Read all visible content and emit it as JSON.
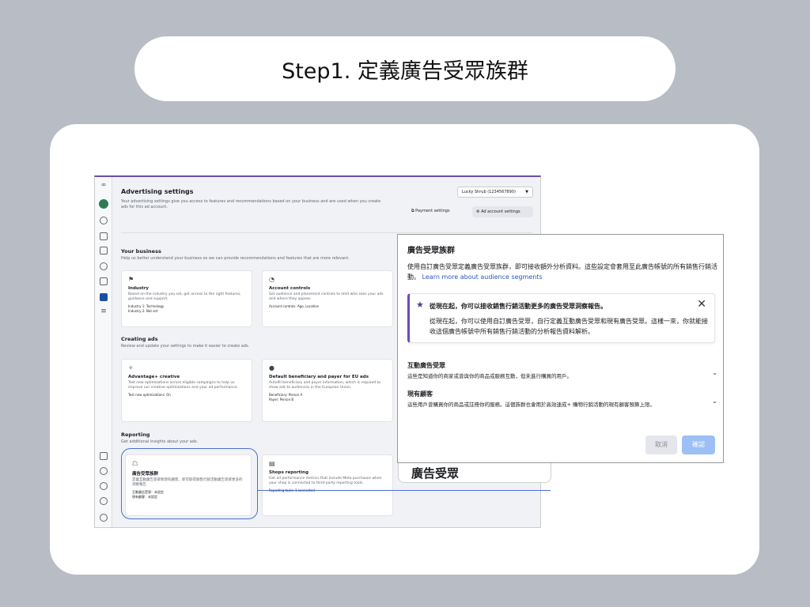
{
  "slide": {
    "heading": "Step1. 定義廣告受眾族群"
  },
  "screenshot": {
    "header": {
      "title": "Advertising settings",
      "description": "Your advertising settings give you access to features and recommendations based on your business and are used when you create ads for this ad account.",
      "account_select": "Lucky Shrub (1234567890)",
      "payment_settings": "Payment settings",
      "ad_account_settings": "Ad account settings"
    },
    "sections": {
      "business": {
        "title": "Your business",
        "desc": "Help us better understand your business so we can provide recommendations and features that are more relevant.",
        "industry": {
          "title": "Industry",
          "desc": "Based on the industry you set, get access to the right features, guidance and support.",
          "meta1": "Industry 1: Technology",
          "meta2": "Industry 2: Not set"
        },
        "account_controls": {
          "title": "Account controls",
          "desc": "Set audience and placement controls to limit who sees your ads and where they appear.",
          "meta1": "Account controls: Age, Location"
        }
      },
      "creating": {
        "title": "Creating ads",
        "desc": "Review and update your settings to make it easier to create ads.",
        "advantage": {
          "title": "Advantage+ creative",
          "desc": "Test new optimizations across eligible campaigns to help us improve our creative optimizations and your ad performance.",
          "meta1": "Test new optimizations: On"
        },
        "beneficiary": {
          "title": "Default beneficiary and payer for EU ads",
          "desc": "Autofill beneficiary and payer information, which is required to show ads to audiences in the European Union.",
          "meta1": "Beneficiary: Person A",
          "meta2": "Payer: Person B"
        }
      },
      "reporting": {
        "title": "Reporting",
        "desc": "Get additional insights about your ads.",
        "audience": {
          "title": "廣告受眾族群",
          "desc": "定義互動廣告受眾和現有顧客，即可取得銷售行銷活動廣告受眾更多的洞察報告",
          "meta1": "互動廣告受眾：未設定",
          "meta2": "現有顧客：未設定"
        },
        "shops": {
          "title": "Shops reporting",
          "desc": "Get ad performance metrics that include Meta purchases when your shop is connected to third-party reporting tools.",
          "meta1": "Reporting tools: 1 connected"
        }
      }
    }
  },
  "behind_panel_label": "廣告受眾",
  "modal": {
    "title": "廣告受眾族群",
    "desc": "使用自訂廣告受眾定義廣告受眾族群，即可接收額外分析資料。這些設定會套用至此廣告帳號的所有銷售行銷活動。",
    "link": "Learn more about audience segments",
    "notice_head": "從現在起，你可以接收銷售行銷活動更多的廣告受眾洞察報告。",
    "notice_body": "從現在起，你可以使用自訂廣告受眾，自行定義互動廣告受眾和現有廣告受眾。這樣一來，你就能接收這個廣告帳號中所有銷售行銷活動的分析報告資料解析。",
    "engaged": {
      "title": "互動廣告受眾",
      "desc": "這些是知道你的商家或曾與你的商品或服務互動，但未進行購買的用戶。"
    },
    "existing": {
      "title": "現有顧客",
      "desc": "這些用戶曾購買你的商品或註冊你的服務。這個族群也會用於高效速成+ 購物行銷活動的現有顧客預算上限。"
    },
    "cancel": "取消",
    "confirm": "確認"
  },
  "icons": [
    "meta-logo-icon",
    "avatar",
    "home-icon",
    "grid-icon",
    "pages-icon",
    "audience-icon",
    "catalog-icon",
    "megaphone-icon",
    "menu-icon",
    "billing-icon",
    "settings-icon",
    "bell-icon",
    "search-icon",
    "help-icon",
    "star-icon",
    "close-icon",
    "chevron-down-icon"
  ],
  "colors": {
    "accent_purple": "#6c4bb6",
    "link_blue": "#2a55c4",
    "confirm_blue": "#9cc0f5",
    "highlight_blue": "#4a6fd1"
  }
}
